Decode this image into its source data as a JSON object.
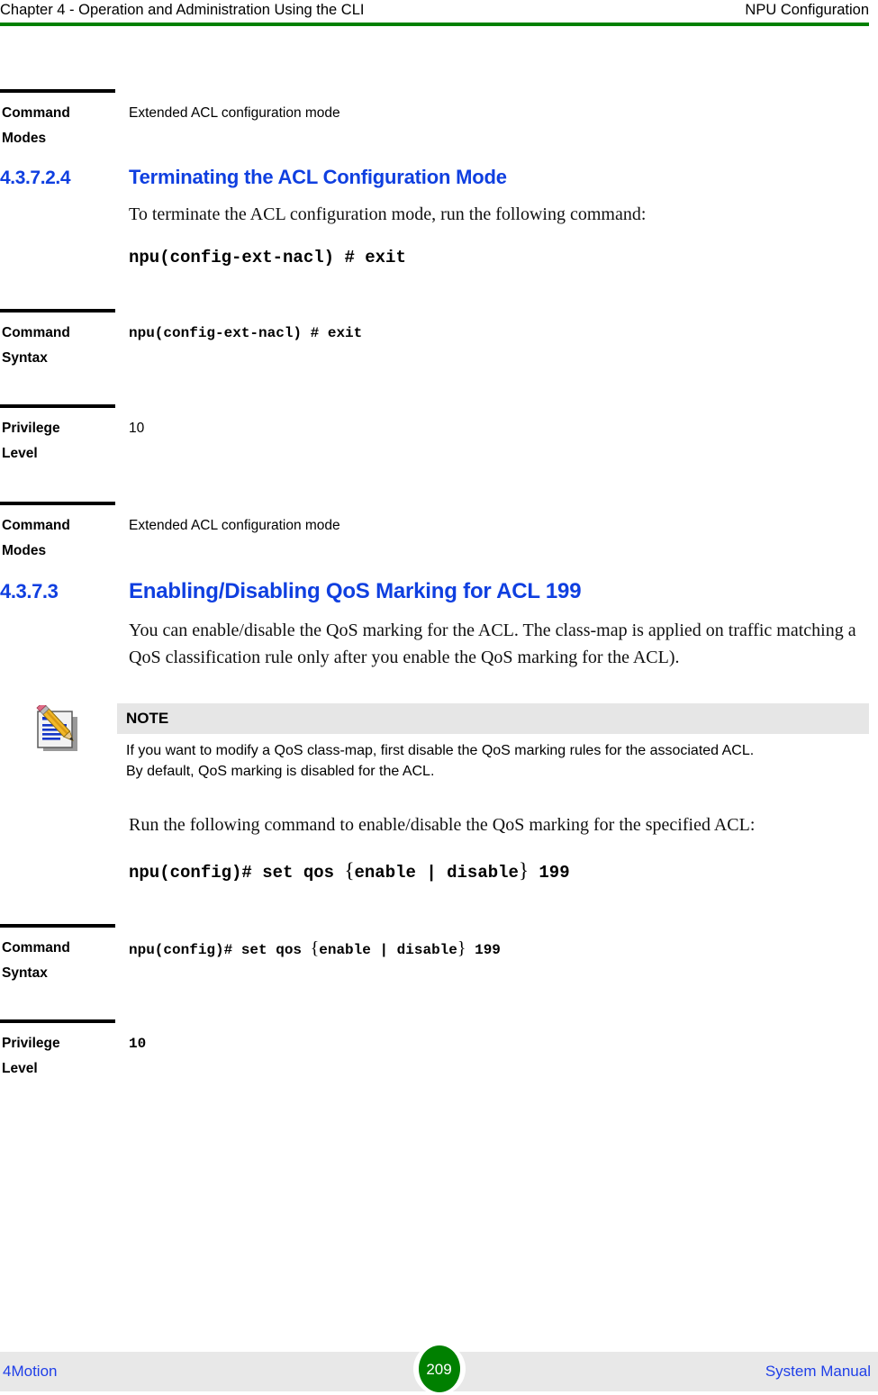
{
  "header": {
    "left": "Chapter 4 - Operation and Administration Using the CLI",
    "right": "NPU Configuration",
    "rule_color": "#008000"
  },
  "blocks": {
    "command_modes_1": {
      "key_line1": "Command",
      "key_line2": "Modes",
      "value": "Extended ACL configuration mode"
    },
    "section_4_3_7_2_4": {
      "number": "4.3.7.2.4",
      "title": "Terminating the ACL Configuration Mode",
      "paragraph": "To terminate the ACL configuration mode, run the following command:",
      "command": "npu(config-ext-nacl) # exit"
    },
    "command_syntax_1": {
      "key_line1": "Command",
      "key_line2": "Syntax",
      "value": "npu(config-ext-nacl) # exit"
    },
    "privilege_level_1": {
      "key_line1": "Privilege",
      "key_line2": "Level",
      "value": "10"
    },
    "command_modes_2": {
      "key_line1": "Command",
      "key_line2": "Modes",
      "value": "Extended ACL configuration mode"
    },
    "section_4_3_7_3": {
      "number": "4.3.7.3",
      "title": "Enabling/Disabling QoS Marking for ACL 199",
      "paragraph": "You can enable/disable the QoS marking for the ACL. The class-map is applied on traffic matching a QoS classification rule only after you enable the QoS marking for the ACL)."
    },
    "note": {
      "icon": "note-pencil-icon",
      "title": "NOTE",
      "line1": "If you want to modify a QoS class-map, first disable the QoS marking rules for the associated ACL.",
      "line2": "By default, QoS marking is disabled for the ACL.",
      "title_bg": "#e6e6e6"
    },
    "post_note_paragraph": "Run the following command to enable/disable the QoS marking for the specified ACL:",
    "qos_command": {
      "part1": "npu(config)# set qos ",
      "brace_open": "{",
      "part2": "enable | disable",
      "brace_close": "}",
      "part3": " 199"
    },
    "command_syntax_2": {
      "key_line1": "Command",
      "key_line2": "Syntax",
      "part1": "npu(config)# set qos ",
      "brace_open": "{",
      "part2": "enable | disable",
      "brace_close": "}",
      "part3": " 199"
    },
    "privilege_level_2": {
      "key_line1": "Privilege",
      "key_line2": "Level",
      "value": "10"
    }
  },
  "footer": {
    "left": "4Motion",
    "page_number": "209",
    "right": "System Manual",
    "badge_color": "#008000",
    "band_color": "#e8e8e8",
    "link_color": "#1f3fe8"
  }
}
